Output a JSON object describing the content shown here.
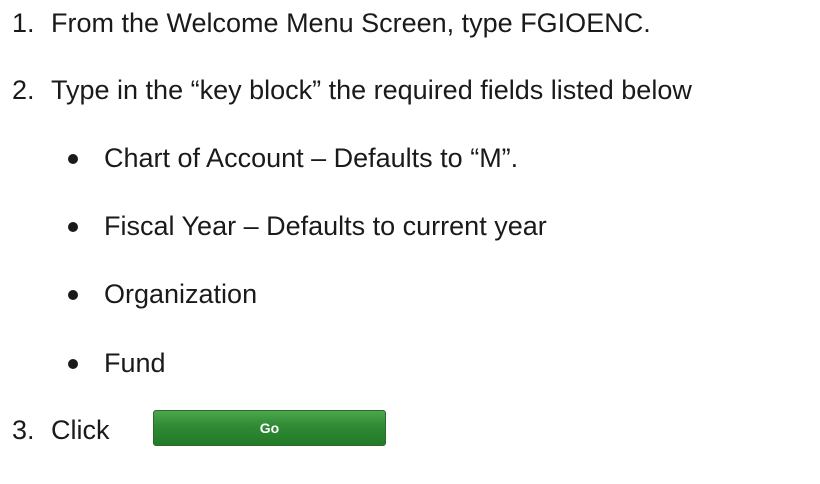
{
  "steps": [
    {
      "number": "1.",
      "text": "From the Welcome Menu Screen, type FGIOENC."
    },
    {
      "number": "2.",
      "text": "Type in the “key block” the required fields listed below"
    },
    {
      "number": "3.",
      "text": "Click"
    }
  ],
  "required_fields": [
    "Chart of Account – Defaults to “M”.",
    "Fiscal Year – Defaults to current year",
    "Organization",
    "Fund"
  ],
  "go_button": {
    "label": "Go",
    "color": "#2f8a34"
  }
}
